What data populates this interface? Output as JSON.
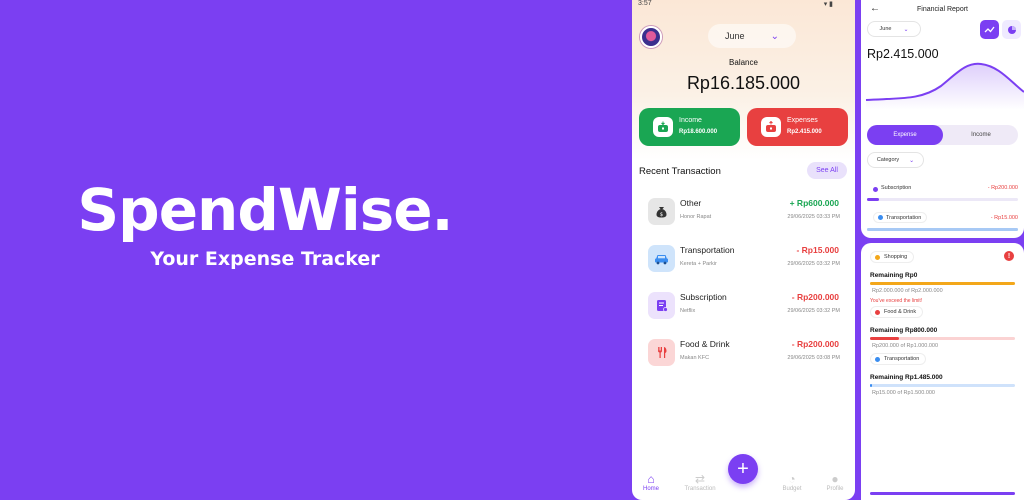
{
  "hero": {
    "title": "SpendWise.",
    "subtitle": "Your Expense Tracker"
  },
  "colors": {
    "background": "#7b3ff2",
    "accent": "#7b3ff2",
    "income": "#1aa653",
    "expense": "#e84040"
  },
  "home": {
    "status_time": "3:57",
    "status_icons": "▾ ▮",
    "month": "June",
    "balance_label": "Balance",
    "balance_value": "Rp16.185.000",
    "income": {
      "title": "Income",
      "value": "Rp18.600.000",
      "icon": "wallet-in-icon"
    },
    "expenses": {
      "title": "Expenses",
      "value": "Rp2.415.000",
      "icon": "wallet-out-icon"
    },
    "recent_title": "Recent Transaction",
    "see_all": "See All",
    "transactions": [
      {
        "name": "Other",
        "note": "Honor Rapat",
        "amount": "+ Rp600.000",
        "time": "29/06/2025 03:33 PM",
        "icon": "money-bag-icon"
      },
      {
        "name": "Transportation",
        "note": "Kereta + Parkir",
        "amount": "- Rp15.000",
        "time": "29/06/2025 03:32 PM",
        "icon": "car-icon"
      },
      {
        "name": "Subscription",
        "note": "Netflix",
        "amount": "- Rp200.000",
        "time": "29/06/2025 03:32 PM",
        "icon": "subscription-icon"
      },
      {
        "name": "Food & Drink",
        "note": "Makan KFC",
        "amount": "- Rp200.000",
        "time": "29/06/2025 03:08 PM",
        "icon": "utensils-icon"
      }
    ],
    "nav": [
      {
        "label": "Home",
        "icon": "home-icon"
      },
      {
        "label": "Transaction",
        "icon": "transaction-icon"
      },
      {
        "label": "Budget",
        "icon": "budget-icon"
      },
      {
        "label": "Profile",
        "icon": "profile-icon"
      }
    ],
    "fab_label": "+"
  },
  "report": {
    "title": "Financial Report",
    "month": "June",
    "total": "Rp2.415.000",
    "tabs": [
      "Expense",
      "Income"
    ],
    "category_label": "Category",
    "rows": [
      {
        "name": "Subscription",
        "amount": "- Rp200.000",
        "color": "#7b3ff2",
        "level": 0.08
      },
      {
        "name": "Transportation",
        "amount": "- Rp15.000",
        "color": "#3a8df0",
        "level": 1.0
      }
    ]
  },
  "budget": {
    "items": [
      {
        "category": "Shopping",
        "remaining": "Remaining Rp0",
        "of": "Rp2.000.000 of Rp2.000.000",
        "warning": "You've exceed the limit!",
        "color": "#f3a71a",
        "bar_bg": "#fde7bf",
        "level": 1.0
      },
      {
        "category": "Food & Drink",
        "remaining": "Remaining Rp800.000",
        "of": "Rp200.000 of Rp1.000.000",
        "warning": "",
        "color": "#e84040",
        "bar_bg": "#fbd3d3",
        "level": 0.2
      },
      {
        "category": "Transportation",
        "remaining": "Remaining Rp1.485.000",
        "of": "Rp15.000 of Rp1.500.000",
        "warning": "",
        "color": "#3a8df0",
        "bar_bg": "#cfe2fb",
        "level": 0.01
      }
    ]
  }
}
